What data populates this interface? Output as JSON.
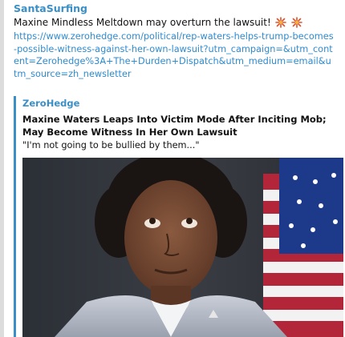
{
  "message": {
    "sender": "SantaSurfing",
    "text": "Maxine Mindless Meltdown may overturn the lawsuit!",
    "emoji_icons": [
      "burst-icon",
      "burst-icon"
    ],
    "link": "https://www.zerohedge.com/political/rep-waters-helps-trump-becomes-possible-witness-against-her-own-lawsuit?utm_campaign=&utm_content=Zerohedge%3A+The+Durden+Dispatch&utm_medium=email&utm_source=zh_newsletter"
  },
  "preview": {
    "site_name": "ZeroHedge",
    "title": "Maxine Waters Leaps Into Victim Mode After Inciting Mob; May Become Witness In Her Own Lawsuit",
    "description": "\"I'm not going to be bullied by them...\"",
    "image_icon": "portrait-photo"
  },
  "colors": {
    "accent": "#3a8fc7",
    "link": "#2f8bd0",
    "emoji": "#e0502a"
  }
}
